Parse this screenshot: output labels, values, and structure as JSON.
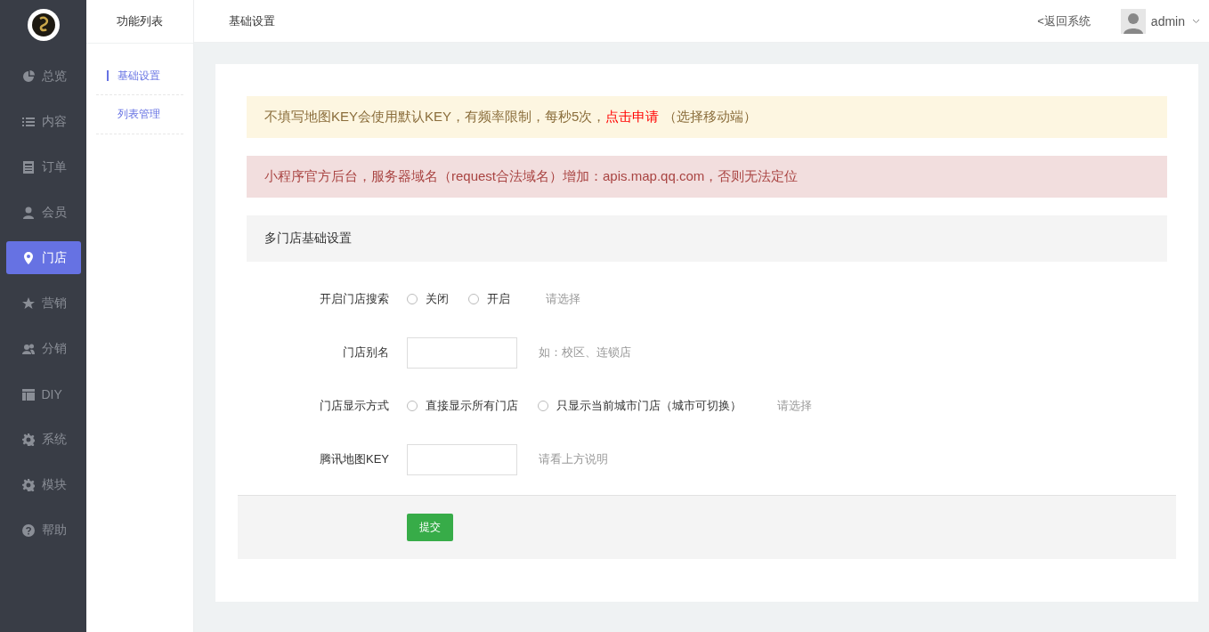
{
  "sidebar": {
    "items": [
      {
        "label": "总览",
        "selected": false
      },
      {
        "label": "内容",
        "selected": false
      },
      {
        "label": "订单",
        "selected": false
      },
      {
        "label": "会员",
        "selected": false
      },
      {
        "label": "门店",
        "selected": true
      },
      {
        "label": "营销",
        "selected": false
      },
      {
        "label": "分销",
        "selected": false
      },
      {
        "label": "DIY",
        "selected": false
      },
      {
        "label": "系统",
        "selected": false
      },
      {
        "label": "模块",
        "selected": false
      },
      {
        "label": "帮助",
        "selected": false
      }
    ]
  },
  "subnav": {
    "title": "功能列表",
    "items": [
      {
        "label": "基础设置",
        "selected": true
      },
      {
        "label": "列表管理",
        "selected": false
      }
    ]
  },
  "header": {
    "title": "基础设置",
    "back_link": "<返回系统",
    "user": "admin"
  },
  "notices": [
    {
      "kind": "warning",
      "text": "不填写地图KEY会使用默认KEY，有频率限制，每秒5次，",
      "link": "点击申请",
      "after": "（选择移动端）"
    },
    {
      "kind": "danger",
      "text": "小程序官方后台，服务器域名（request合法域名）增加：apis.map.qq.com，否则无法定位"
    }
  ],
  "section": {
    "title": "多门店基础设置"
  },
  "form": [
    {
      "kind": "radio",
      "label": "开启门店搜索",
      "options": [
        {
          "label": "关闭",
          "selected": false
        },
        {
          "label": "开启",
          "selected": false
        }
      ],
      "hint": "请选择"
    },
    {
      "kind": "text",
      "label": "门店别名",
      "hint": "如：校区、连锁店"
    },
    {
      "kind": "radio",
      "label": "门店显示方式",
      "options": [
        {
          "label": "直接显示所有门店",
          "selected": false
        },
        {
          "label": "只显示当前城市门店（城市可切换）",
          "selected": false
        }
      ],
      "hint": "请选择"
    },
    {
      "kind": "text",
      "label": "腾讯地图KEY",
      "hint": "请看上方说明"
    }
  ],
  "submit": "提交"
}
